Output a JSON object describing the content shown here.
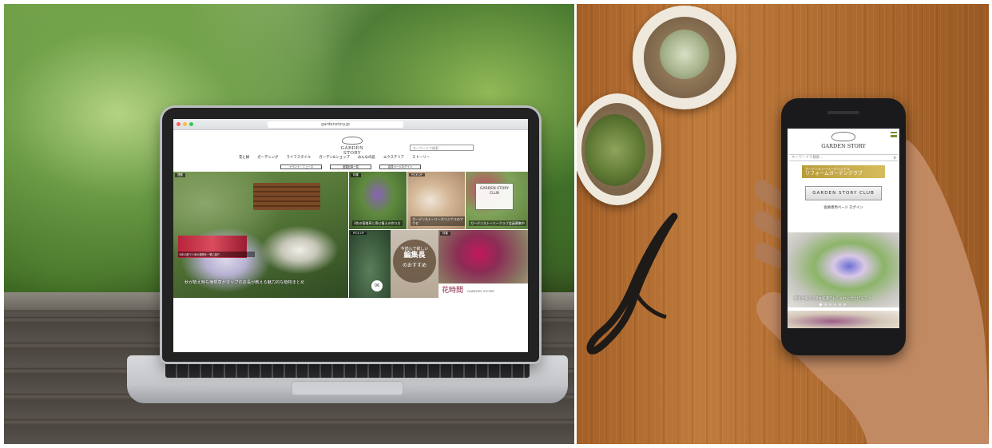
{
  "laptop_site": {
    "url": "gardenstory.jp",
    "logo": "GARDEN STORY",
    "search_placeholder": "キーワードで検索...",
    "nav": [
      "花と緑",
      "ガーデニング",
      "ライフスタイル",
      "ガーデン&ショップ",
      "みんなの庭",
      "エクステリア",
      "ストーリー"
    ],
    "pills": [
      "イベント・ニュース",
      "連載記事一覧",
      "会員ページログイン"
    ],
    "hero_tag": "連載",
    "hero_caption": "秋が植え時も宿根草がタップの店長が教える魅力的な植物まとめ",
    "hero_small_text": "今年の庭で人気の植物を一挙に紹介",
    "tiles": [
      {
        "tag": "特集",
        "caption": "3色の宿根草と寄せ植えの作り方"
      },
      {
        "tag": "PICK UP",
        "caption": "ガーデンストーリーオリジナルのアクセ"
      },
      {
        "tag": "",
        "club": "GARDEN STORY CLUB",
        "caption": "ガーデンストーリークラブ会員募集中"
      }
    ],
    "pick_up_tag": "PICK UP",
    "editor_pick": {
      "line1": "今読んで欲しい",
      "line2": "編集長",
      "line3": "のおすすめ",
      "number": "06"
    },
    "hanajikan": "花時間",
    "hanajikan_brand": "GARDEN STORY",
    "special_tag": "特集"
  },
  "phone_site": {
    "logo": "GARDEN STORY",
    "search_placeholder": "キーワードで検索...",
    "banner_small": "ガーデンストーリーオリジナル",
    "banner_title": "リフォームガーデンクラブ",
    "club_button": "GARDEN STORY CLUB",
    "login_text": "会員専用ページ ログイン",
    "hero_caption": "春寄せ植えの基本知識でおしゃれに仕上げるコツ"
  }
}
